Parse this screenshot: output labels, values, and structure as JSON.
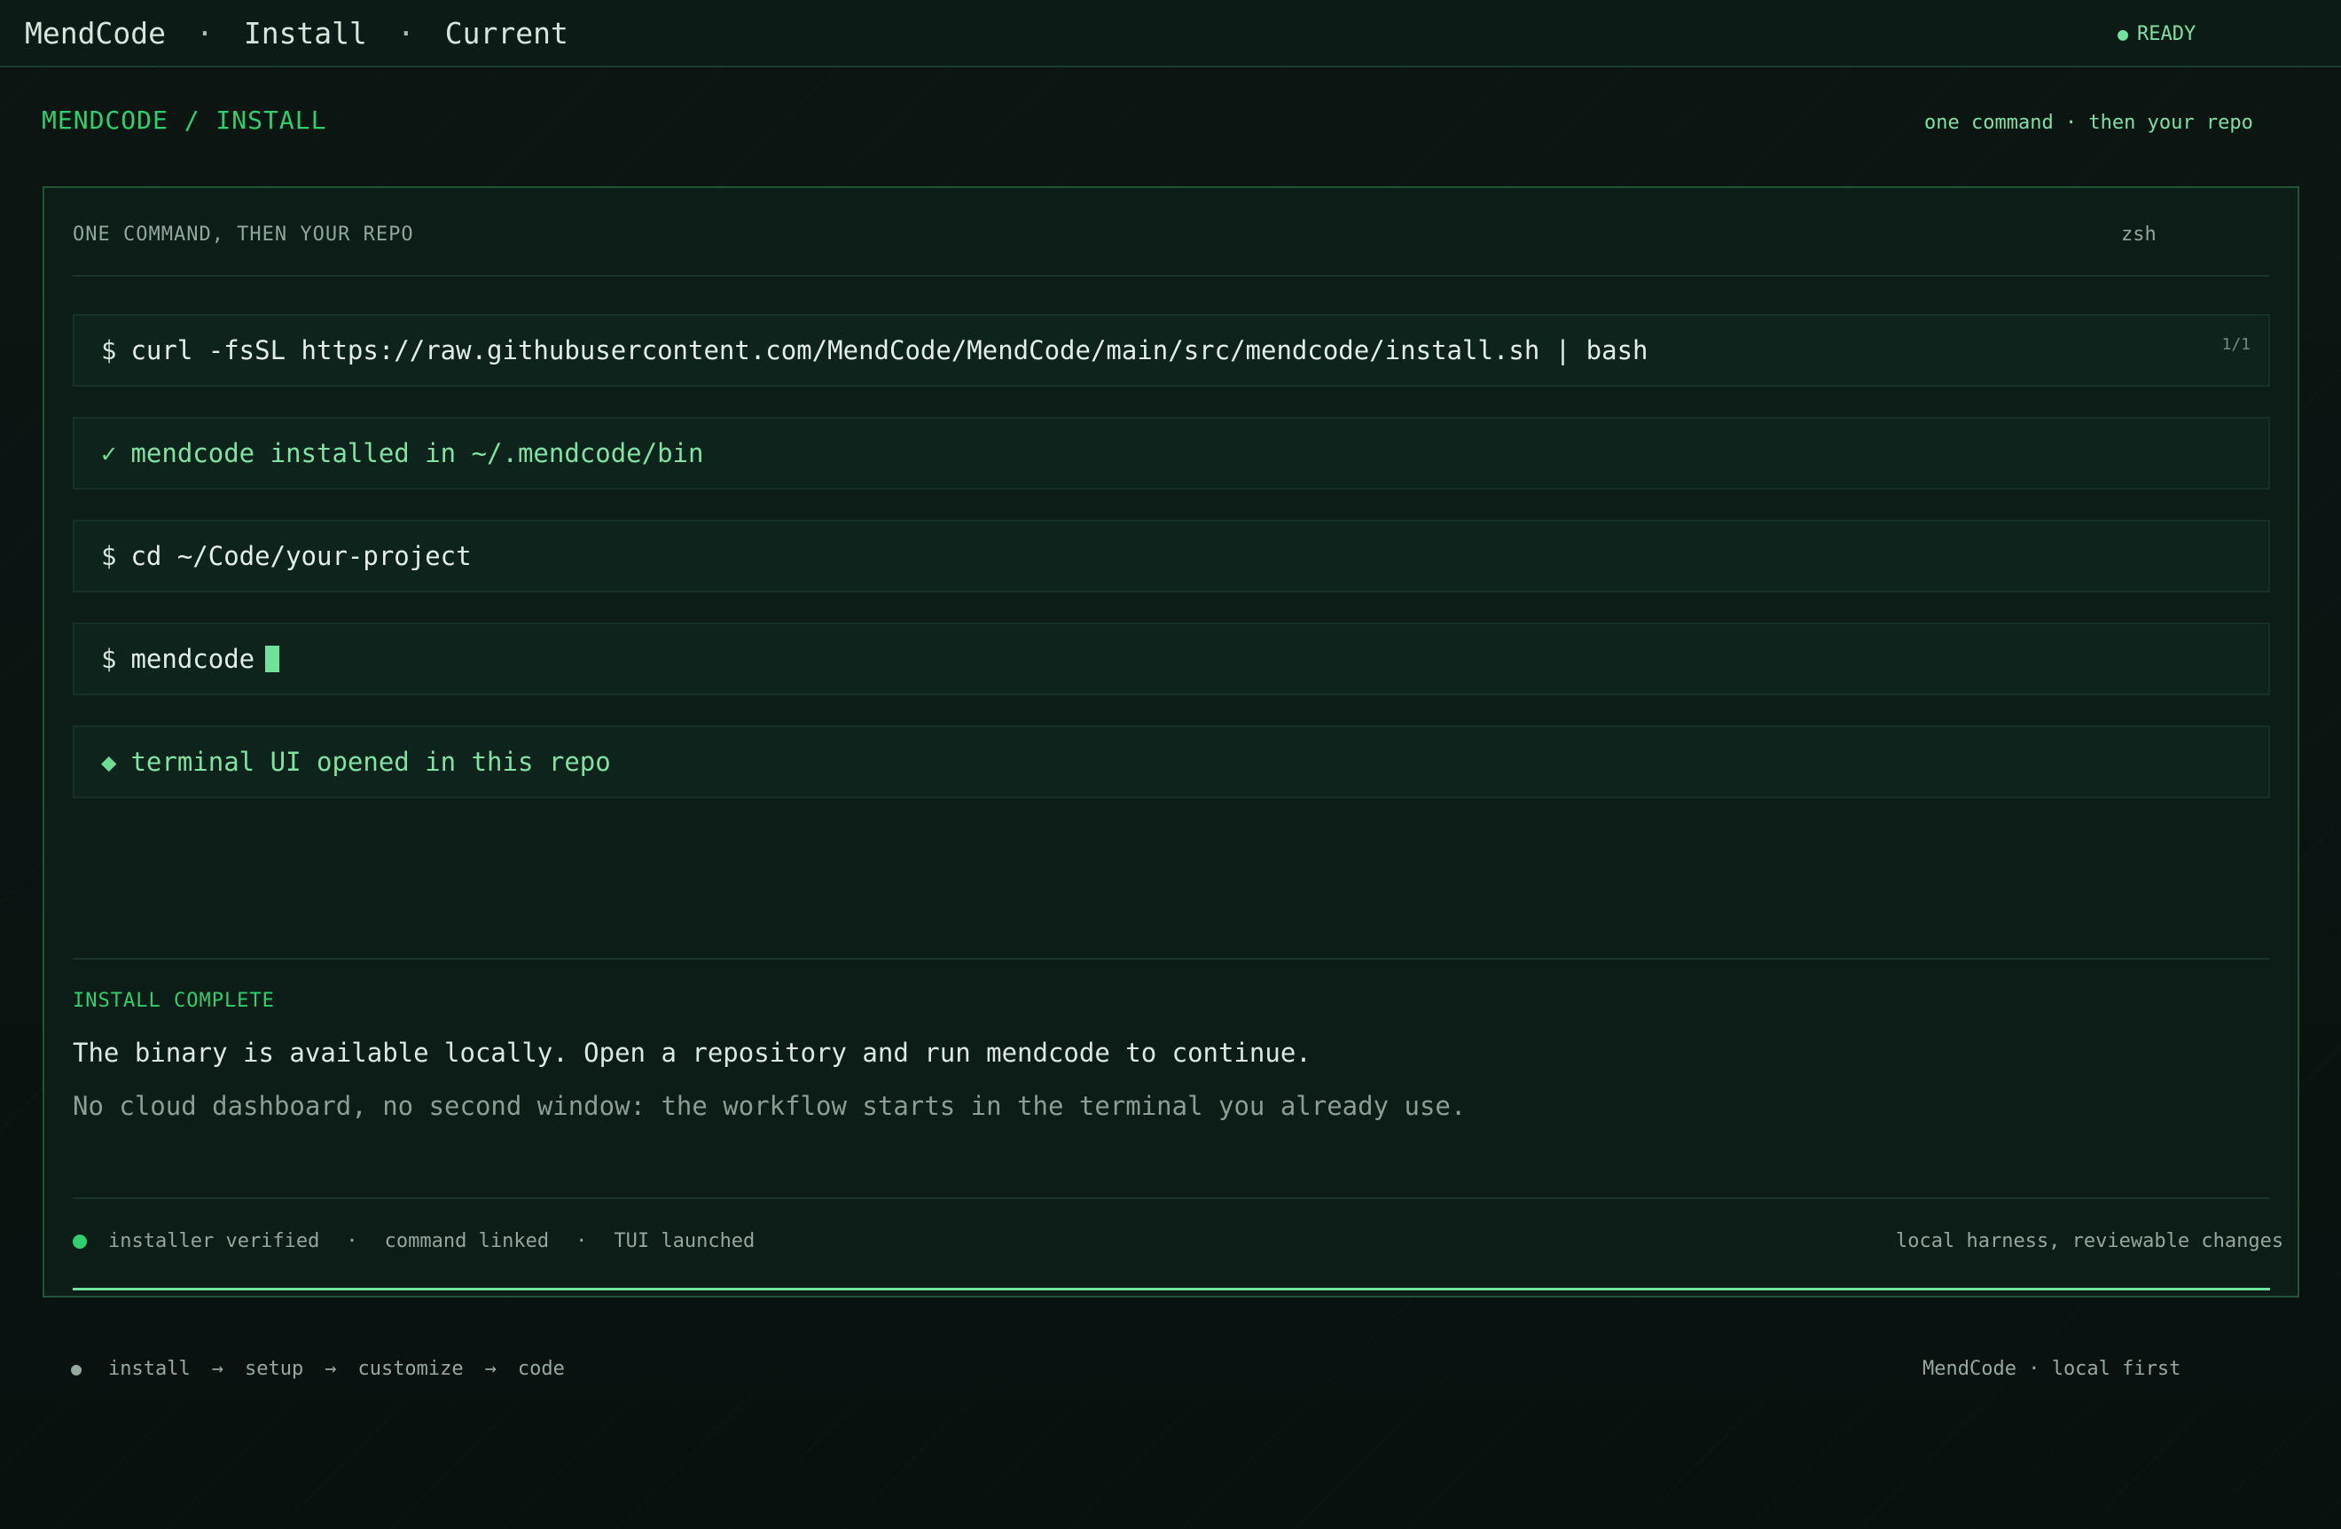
{
  "topbar": {
    "nav": [
      "MendCode",
      "Install",
      "Current"
    ],
    "separator": "·",
    "status_dot": "●",
    "status": "READY"
  },
  "breadcrumb": "MENDCODE / INSTALL",
  "tagline": "one command · then your repo",
  "panel": {
    "title": "ONE COMMAND, THEN YOUR REPO",
    "shell": "zsh",
    "lines": [
      {
        "prefix": "$",
        "text": "curl -fsSL https://raw.githubusercontent.com/MendCode/MendCode/main/src/mendcode/install.sh | bash",
        "counter": "1/1"
      },
      {
        "prefix": "✓",
        "text": "mendcode installed in ~/.mendcode/bin"
      },
      {
        "prefix": "$",
        "text": "cd ~/Code/your-project"
      },
      {
        "prefix": "$",
        "text": "mendcode"
      },
      {
        "prefix": "◆",
        "text": "terminal UI opened in this repo"
      }
    ],
    "complete_label": "INSTALL COMPLETE",
    "complete_main": "The binary is available locally. Open a repository and run mendcode to continue.",
    "complete_sub": "No cloud dashboard, no second window: the workflow starts in the terminal you already use.",
    "checks": [
      "installer verified",
      "command linked",
      "TUI launched"
    ],
    "checks_sep": "·",
    "harness": "local harness, reviewable changes"
  },
  "footer": {
    "bullet": "●",
    "flow": [
      "install",
      "setup",
      "customize",
      "code"
    ],
    "arrow": "→",
    "brand": "MendCode · local first"
  },
  "colors": {
    "accent": "#2fcf6e",
    "accent_light": "#6fe39b",
    "background": "#0a1210",
    "panel": "#0c1c17"
  }
}
